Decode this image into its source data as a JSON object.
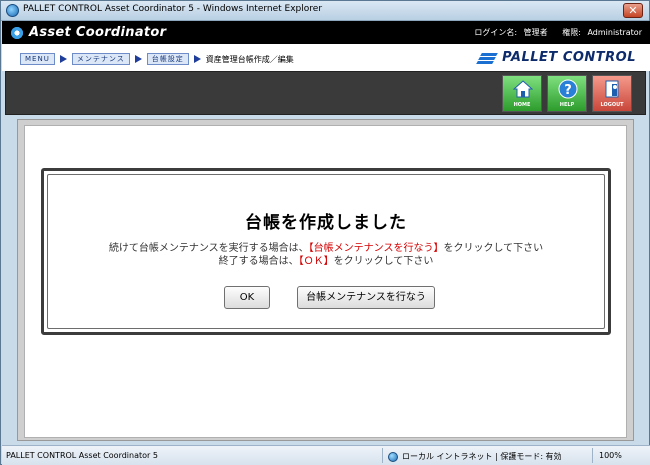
{
  "window": {
    "title": "PALLET CONTROL Asset Coordinator 5 - Windows Internet Explorer",
    "close_glyph": "✕"
  },
  "header": {
    "logo": "Asset Coordinator",
    "login_label": "ログイン名:",
    "login_value": "管理者",
    "role_label": "権限:",
    "role_value": "Administrator"
  },
  "breadcrumb": {
    "items": [
      "MENU",
      "メンテナンス",
      "台帳設定"
    ],
    "current": "資産管理台帳作成／編集"
  },
  "brand": "PALLET CONTROL",
  "toolbar": {
    "home": "HOME",
    "help": "HELP",
    "logout": "LOGOUT"
  },
  "dialog": {
    "title": "台帳を作成しました",
    "line1_pre": "続けて台帳メンテナンスを実行する場合は、",
    "line1_em": "【台帳メンテナンスを行なう】",
    "line1_post": "をクリックして下さい",
    "line2_pre": "終了する場合は、",
    "line2_em": "【ＯＫ】",
    "line2_post": "をクリックして下さい",
    "ok_label": "OK",
    "maint_label": "台帳メンテナンスを行なう"
  },
  "status": {
    "left": "PALLET CONTROL Asset Coordinator 5",
    "zone": "ローカル イントラネット | 保護モード: 有効",
    "zoom": "100%"
  },
  "colors": {
    "accent_red": "#d40000",
    "header_bg": "#000000",
    "toolbar_bg": "#3a3a3a"
  }
}
